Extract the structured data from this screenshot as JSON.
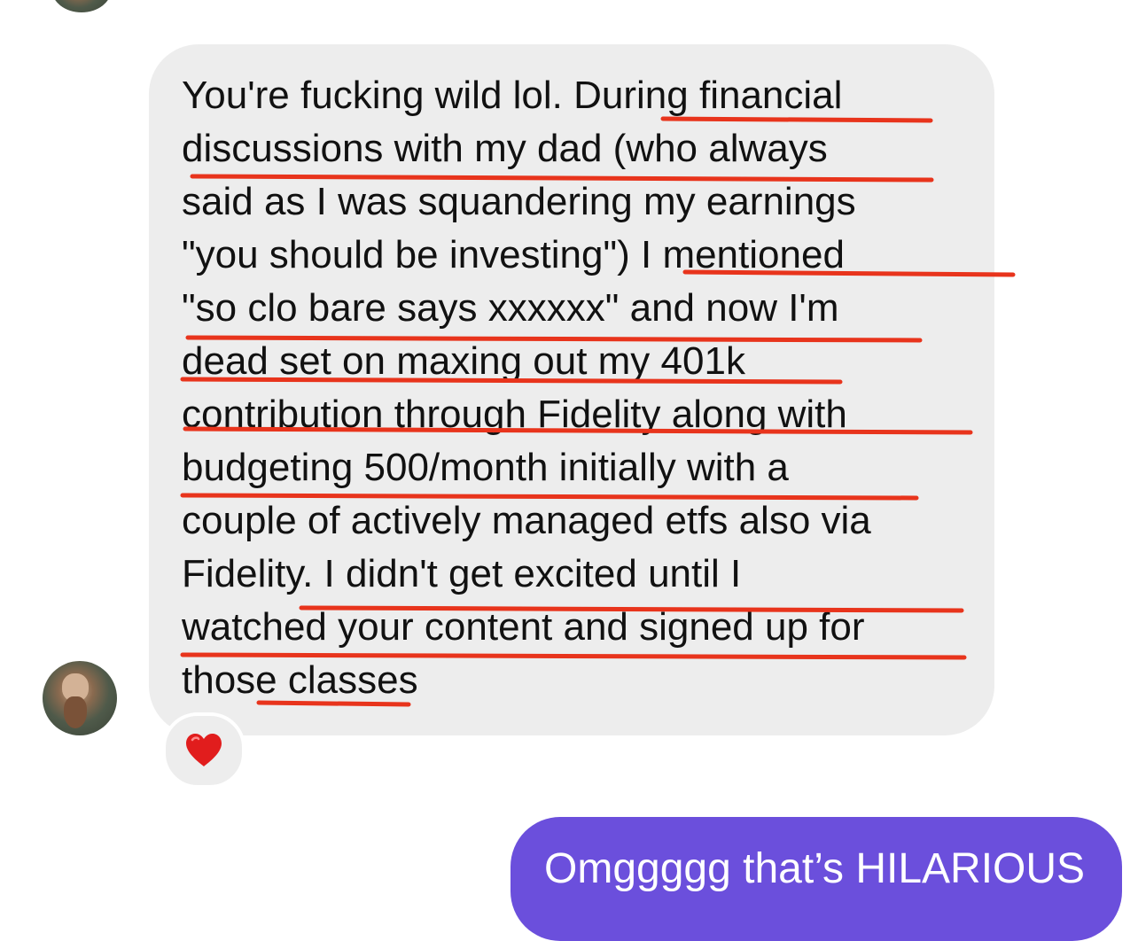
{
  "conversation": {
    "incoming": {
      "lines": [
        "You're fucking wild lol. During financial",
        "discussions with my dad (who always",
        "said as I was squandering my earnings",
        "\"you should be investing\") I mentioned",
        "\"so clo bare says xxxxxx\" and now I'm",
        "dead set on maxing out my 401k",
        "contribution through Fidelity along with",
        "budgeting 500/month initially with a",
        "couple of actively managed etfs also via",
        "Fidelity. I didn't get excited until I",
        "watched your content and signed up for",
        "those classes"
      ],
      "reaction": "❤️",
      "annotation_color": "#e8341c"
    },
    "outgoing": {
      "text": "Omggggg that’s HILARIOUS",
      "bubble_color": "#6b4fdc"
    }
  }
}
